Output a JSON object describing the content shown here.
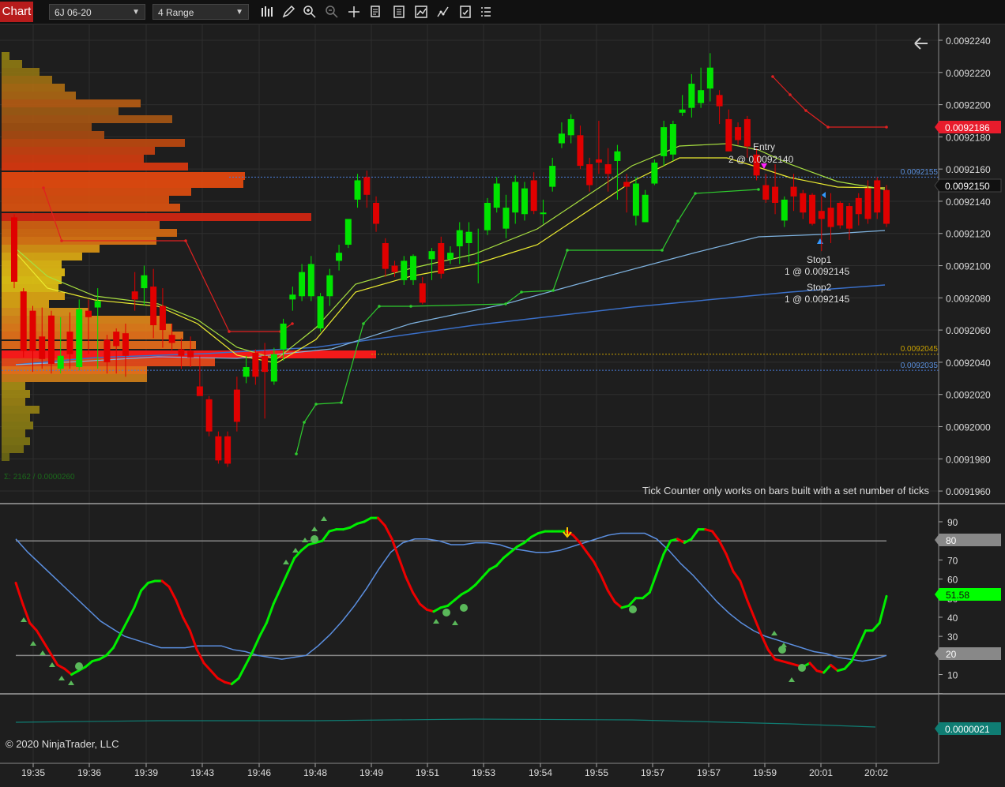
{
  "toolbar": {
    "tab_label": "Chart",
    "instrument": "6J 06-20",
    "bar_type": "4 Range",
    "icons": [
      "bar-type-icon",
      "draw-icon",
      "zoom-in-icon",
      "zoom-out-icon",
      "crosshair-icon",
      "data-box-icon",
      "properties-icon",
      "indicators-icon",
      "strategies-icon",
      "templates-icon"
    ]
  },
  "price_axis": {
    "ticks": [
      "0.0092240",
      "0.0092220",
      "0.0092200",
      "0.0092180",
      "0.0092160",
      "0.0092140",
      "0.0092120",
      "0.0092100",
      "0.0092080",
      "0.0092060",
      "0.0092040",
      "0.0092020",
      "0.0092000",
      "0.0091980",
      "0.0091960"
    ],
    "last_price_label": "0.0092150",
    "stop_price_label": "0.0092186",
    "level_labels": [
      "0.0092155",
      "0.0092045",
      "0.0092035"
    ]
  },
  "annotations": {
    "entry_title": "Entry",
    "entry_detail": "2 @ 0.0092140",
    "stop1_title": "Stop1",
    "stop1_detail": "1 @ 0.0092145",
    "stop2_title": "Stop2",
    "stop2_detail": "1 @ 0.0092145",
    "tick_counter_msg": "Tick Counter only works on bars built with a set number of ticks",
    "volume_profile_sum": "Σ: 2162 / 0.0000260",
    "copyright": "© 2020 NinjaTrader, LLC"
  },
  "osc_axis": {
    "ticks": [
      "90",
      "70",
      "60",
      "50",
      "40",
      "30",
      "10"
    ],
    "overbought_label": "80",
    "oversold_label": "20",
    "current_label": "51.58"
  },
  "bottom_panel": {
    "value_label": "0.0000021"
  },
  "time_axis": {
    "labels": [
      "19:35",
      "19:36",
      "19:39",
      "19:43",
      "19:46",
      "19:48",
      "19:49",
      "19:51",
      "19:53",
      "19:54",
      "19:55",
      "19:57",
      "19:57",
      "19:59",
      "20:01",
      "20:02"
    ]
  },
  "colors": {
    "background": "#1e1e1e",
    "up_candle": "#00e400",
    "down_candle": "#e00000",
    "stop_label": "#e81c2c",
    "price_label": "#111111",
    "osc_current": "#00ff00",
    "bottom_label": "#0f7d73"
  },
  "chart_data": [
    {
      "type": "candlestick",
      "title": "6J 06-20 4 Range",
      "ylim": [
        0.0091955,
        0.009225
      ],
      "y_ticks": [
        0.009224,
        0.009222,
        0.00922,
        0.009218,
        0.009216,
        0.009214,
        0.009212,
        0.00921,
        0.009208,
        0.009206,
        0.009204,
        0.009202,
        0.0092,
        0.009198,
        0.009196
      ],
      "candles": [
        {
          "o": 0.009213,
          "h": 0.0092132,
          "l": 0.0092086,
          "c": 0.009209
        },
        {
          "o": 0.0092084,
          "h": 0.0092086,
          "l": 0.0092043,
          "c": 0.0092047
        },
        {
          "o": 0.0092072,
          "h": 0.0092075,
          "l": 0.0092034,
          "c": 0.0092047
        },
        {
          "o": 0.0092056,
          "h": 0.0092074,
          "l": 0.0092036,
          "c": 0.0092042
        },
        {
          "o": 0.0092069,
          "h": 0.0092072,
          "l": 0.0092033,
          "c": 0.0092039
        },
        {
          "o": 0.0092036,
          "h": 0.0092068,
          "l": 0.0092033,
          "c": 0.0092044
        },
        {
          "o": 0.0092059,
          "h": 0.0092071,
          "l": 0.0092036,
          "c": 0.0092045
        },
        {
          "o": 0.0092037,
          "h": 0.0092079,
          "l": 0.0092035,
          "c": 0.0092073
        },
        {
          "o": 0.0092072,
          "h": 0.0092079,
          "l": 0.0092045,
          "c": 0.0092068
        },
        {
          "o": 0.0092074,
          "h": 0.0092086,
          "l": 0.0092036,
          "c": 0.0092078
        },
        {
          "o": 0.0092054,
          "h": 0.0092057,
          "l": 0.0092033,
          "c": 0.009204
        },
        {
          "o": 0.0092059,
          "h": 0.0092061,
          "l": 0.0092033,
          "c": 0.009205
        },
        {
          "o": 0.0092058,
          "h": 0.0092064,
          "l": 0.0092031,
          "c": 0.0092044
        },
        {
          "o": 0.0092084,
          "h": 0.0092096,
          "l": 0.0092072,
          "c": 0.0092079
        },
        {
          "o": 0.0092086,
          "h": 0.00921,
          "l": 0.0092075,
          "c": 0.0092094
        },
        {
          "o": 0.0092087,
          "h": 0.0092098,
          "l": 0.0092055,
          "c": 0.0092063
        },
        {
          "o": 0.0092075,
          "h": 0.0092086,
          "l": 0.0092049,
          "c": 0.009206
        },
        {
          "o": 0.0092057,
          "h": 0.0092064,
          "l": 0.0092047,
          "c": 0.0092052
        },
        {
          "o": 0.0092048,
          "h": 0.0092055,
          "l": 0.0092036,
          "c": 0.0092044
        },
        {
          "o": 0.0092047,
          "h": 0.0092056,
          "l": 0.0092037,
          "c": 0.0092043
        },
        {
          "o": 0.0092025,
          "h": 0.0092044,
          "l": 0.0092022,
          "c": 0.0092019
        },
        {
          "o": 0.0092017,
          "h": 0.0092019,
          "l": 0.0091994,
          "c": 0.0091997
        },
        {
          "o": 0.0091994,
          "h": 0.0091997,
          "l": 0.0091977,
          "c": 0.0091979
        },
        {
          "o": 0.0091994,
          "h": 0.0091997,
          "l": 0.0091975,
          "c": 0.0091977
        },
        {
          "o": 0.0092023,
          "h": 0.0092031,
          "l": 0.0091997,
          "c": 0.0092003
        },
        {
          "o": 0.0092031,
          "h": 0.0092044,
          "l": 0.0092027,
          "c": 0.0092037
        },
        {
          "o": 0.0092046,
          "h": 0.0092048,
          "l": 0.0092026,
          "c": 0.0092031
        },
        {
          "o": 0.0092044,
          "h": 0.0092052,
          "l": 0.0092005,
          "c": 0.0092034
        },
        {
          "o": 0.0092028,
          "h": 0.0092049,
          "l": 0.0092026,
          "c": 0.0092045
        },
        {
          "o": 0.0092048,
          "h": 0.0092067,
          "l": 0.0092041,
          "c": 0.0092064
        },
        {
          "o": 0.0092079,
          "h": 0.0092087,
          "l": 0.0092072,
          "c": 0.0092082
        },
        {
          "o": 0.0092081,
          "h": 0.0092101,
          "l": 0.0092078,
          "c": 0.0092096
        },
        {
          "o": 0.0092081,
          "h": 0.0092106,
          "l": 0.0092078,
          "c": 0.0092101
        },
        {
          "o": 0.0092061,
          "h": 0.0092083,
          "l": 0.0092059,
          "c": 0.0092081
        },
        {
          "o": 0.0092081,
          "h": 0.0092098,
          "l": 0.0092075,
          "c": 0.0092094
        },
        {
          "o": 0.0092103,
          "h": 0.0092113,
          "l": 0.0092097,
          "c": 0.0092108
        },
        {
          "o": 0.0092113,
          "h": 0.0092128,
          "l": 0.0092111,
          "c": 0.0092129
        },
        {
          "o": 0.0092141,
          "h": 0.0092157,
          "l": 0.0092136,
          "c": 0.0092153
        },
        {
          "o": 0.0092155,
          "h": 0.0092159,
          "l": 0.0092136,
          "c": 0.0092144
        },
        {
          "o": 0.0092139,
          "h": 0.0092143,
          "l": 0.0092121,
          "c": 0.0092126
        },
        {
          "o": 0.0092114,
          "h": 0.0092117,
          "l": 0.0092093,
          "c": 0.0092098
        },
        {
          "o": 0.00921,
          "h": 0.0092103,
          "l": 0.0092093,
          "c": 0.0092096
        },
        {
          "o": 0.0092091,
          "h": 0.0092106,
          "l": 0.0092088,
          "c": 0.0092103
        },
        {
          "o": 0.0092091,
          "h": 0.0092107,
          "l": 0.0092088,
          "c": 0.0092106
        },
        {
          "o": 0.0092089,
          "h": 0.0092093,
          "l": 0.0092076,
          "c": 0.0092077
        },
        {
          "o": 0.0092104,
          "h": 0.0092111,
          "l": 0.0092091,
          "c": 0.0092109
        },
        {
          "o": 0.0092114,
          "h": 0.0092118,
          "l": 0.0092092,
          "c": 0.0092095
        },
        {
          "o": 0.0092104,
          "h": 0.0092112,
          "l": 0.0092101,
          "c": 0.0092108
        },
        {
          "o": 0.0092112,
          "h": 0.0092127,
          "l": 0.0092101,
          "c": 0.0092122
        },
        {
          "o": 0.0092114,
          "h": 0.0092127,
          "l": 0.0092102,
          "c": 0.0092121
        },
        {
          "o": 0.0092102,
          "h": 0.0092123,
          "l": 0.0092089,
          "c": 0.0092102
        },
        {
          "o": 0.0092122,
          "h": 0.0092142,
          "l": 0.0092119,
          "c": 0.0092139
        },
        {
          "o": 0.0092136,
          "h": 0.0092155,
          "l": 0.0092133,
          "c": 0.0092151
        },
        {
          "o": 0.0092123,
          "h": 0.0092144,
          "l": 0.0092117,
          "c": 0.0092136
        },
        {
          "o": 0.0092133,
          "h": 0.0092156,
          "l": 0.0092126,
          "c": 0.0092152
        },
        {
          "o": 0.0092132,
          "h": 0.0092152,
          "l": 0.0092128,
          "c": 0.0092148
        },
        {
          "o": 0.0092153,
          "h": 0.0092158,
          "l": 0.0092132,
          "c": 0.0092134
        },
        {
          "o": 0.0092132,
          "h": 0.0092141,
          "l": 0.0092126,
          "c": 0.0092133
        },
        {
          "o": 0.0092149,
          "h": 0.0092167,
          "l": 0.0092146,
          "c": 0.0092162
        },
        {
          "o": 0.0092176,
          "h": 0.0092189,
          "l": 0.0092173,
          "c": 0.0092182
        },
        {
          "o": 0.0092181,
          "h": 0.0092194,
          "l": 0.0092176,
          "c": 0.0092191
        },
        {
          "o": 0.0092181,
          "h": 0.0092187,
          "l": 0.009216,
          "c": 0.0092162
        },
        {
          "o": 0.0092163,
          "h": 0.0092167,
          "l": 0.0092146,
          "c": 0.009215
        },
        {
          "o": 0.0092166,
          "h": 0.009219,
          "l": 0.0092157,
          "c": 0.0092164
        },
        {
          "o": 0.0092163,
          "h": 0.0092173,
          "l": 0.0092146,
          "c": 0.0092157
        },
        {
          "o": 0.0092165,
          "h": 0.0092175,
          "l": 0.0092141,
          "c": 0.0092171
        },
        {
          "o": 0.0092152,
          "h": 0.0092157,
          "l": 0.0092133,
          "c": 0.0092149
        },
        {
          "o": 0.0092131,
          "h": 0.0092155,
          "l": 0.0092125,
          "c": 0.0092151
        },
        {
          "o": 0.0092127,
          "h": 0.0092147,
          "l": 0.0092127,
          "c": 0.0092144
        },
        {
          "o": 0.0092151,
          "h": 0.0092166,
          "l": 0.009215,
          "c": 0.0092164
        },
        {
          "o": 0.0092168,
          "h": 0.009219,
          "l": 0.0092162,
          "c": 0.0092186
        },
        {
          "o": 0.0092169,
          "h": 0.009219,
          "l": 0.0092165,
          "c": 0.0092188
        },
        {
          "o": 0.0092195,
          "h": 0.0092206,
          "l": 0.0092193,
          "c": 0.0092197
        },
        {
          "o": 0.0092198,
          "h": 0.0092219,
          "l": 0.0092192,
          "c": 0.0092213
        },
        {
          "o": 0.0092201,
          "h": 0.0092223,
          "l": 0.0092198,
          "c": 0.0092209
        },
        {
          "o": 0.009221,
          "h": 0.0092232,
          "l": 0.0092202,
          "c": 0.0092223
        },
        {
          "o": 0.0092206,
          "h": 0.0092209,
          "l": 0.0092188,
          "c": 0.0092199
        },
        {
          "o": 0.0092191,
          "h": 0.0092197,
          "l": 0.0092171,
          "c": 0.0092171
        },
        {
          "o": 0.0092186,
          "h": 0.0092189,
          "l": 0.0092175,
          "c": 0.0092178
        },
        {
          "o": 0.0092191,
          "h": 0.0092193,
          "l": 0.0092167,
          "c": 0.0092174
        },
        {
          "o": 0.0092169,
          "h": 0.0092173,
          "l": 0.0092153,
          "c": 0.0092156
        },
        {
          "o": 0.009215,
          "h": 0.0092157,
          "l": 0.0092139,
          "c": 0.0092141
        },
        {
          "o": 0.0092149,
          "h": 0.0092163,
          "l": 0.0092132,
          "c": 0.0092139
        },
        {
          "o": 0.0092128,
          "h": 0.0092143,
          "l": 0.0092124,
          "c": 0.0092141
        },
        {
          "o": 0.0092149,
          "h": 0.0092157,
          "l": 0.0092134,
          "c": 0.0092143
        },
        {
          "o": 0.0092145,
          "h": 0.0092147,
          "l": 0.0092129,
          "c": 0.0092133
        },
        {
          "o": 0.0092144,
          "h": 0.0092145,
          "l": 0.0092125,
          "c": 0.0092126
        },
        {
          "o": 0.0092134,
          "h": 0.0092143,
          "l": 0.0092109,
          "c": 0.0092129
        },
        {
          "o": 0.0092136,
          "h": 0.0092145,
          "l": 0.0092114,
          "c": 0.0092124
        },
        {
          "o": 0.0092139,
          "h": 0.009214,
          "l": 0.0092123,
          "c": 0.0092125
        },
        {
          "o": 0.0092137,
          "h": 0.0092139,
          "l": 0.0092116,
          "c": 0.0092123
        },
        {
          "o": 0.0092142,
          "h": 0.0092145,
          "l": 0.0092125,
          "c": 0.0092132
        },
        {
          "o": 0.0092148,
          "h": 0.0092153,
          "l": 0.0092126,
          "c": 0.0092129
        },
        {
          "o": 0.0092153,
          "h": 0.0092155,
          "l": 0.0092129,
          "c": 0.0092133
        },
        {
          "o": 0.0092147,
          "h": 0.009215,
          "l": 0.0092124,
          "c": 0.0092126
        }
      ],
      "price_levels": [
        0.0092155,
        0.0092045,
        0.0092035
      ],
      "last_price": 0.009215,
      "stop_price": 0.0092186
    },
    {
      "type": "line",
      "ylim": [
        0,
        100
      ],
      "y_ticks": [
        90,
        80,
        70,
        60,
        50,
        40,
        30,
        20,
        10
      ],
      "overbought": 80,
      "oversold": 20,
      "current": 51.58,
      "series": [
        {
          "values": [
            58,
            47,
            37,
            33,
            27,
            21,
            15,
            13,
            10,
            12,
            14,
            17,
            18,
            20,
            24,
            31,
            38,
            45,
            54,
            58,
            59,
            59,
            56,
            49,
            40,
            33,
            23,
            16,
            12,
            8,
            6,
            5,
            8,
            15,
            22,
            30,
            37,
            47,
            55,
            63,
            71,
            75,
            78,
            79,
            80,
            85,
            86,
            86,
            87,
            89,
            90,
            92,
            92,
            88,
            81,
            71,
            61,
            53,
            47,
            44,
            43,
            45,
            46,
            49,
            52,
            54,
            57,
            61,
            65,
            67,
            71,
            74,
            77,
            79,
            82,
            84,
            85,
            85,
            85,
            85,
            83,
            79,
            74,
            69,
            62,
            54,
            48,
            45,
            46,
            50,
            50,
            53,
            63,
            73,
            80,
            81,
            79,
            81,
            86,
            86,
            85,
            80,
            73,
            64,
            59,
            49,
            40,
            31,
            23,
            18,
            17,
            16,
            15,
            14,
            16,
            12,
            11,
            15,
            12,
            13,
            17,
            25,
            33,
            33,
            37,
            51
          ]
        },
        {
          "values": [
            81,
            74,
            68,
            62,
            56,
            50,
            44,
            38,
            34,
            30,
            28,
            26,
            24,
            24,
            24,
            25,
            25,
            25,
            23,
            22,
            20,
            19,
            18,
            19,
            20,
            25,
            31,
            38,
            46,
            55,
            65,
            74,
            79,
            81,
            81,
            80,
            78,
            78,
            79,
            79,
            78,
            76,
            75,
            74,
            74,
            75,
            77,
            79,
            81,
            83,
            84,
            84,
            84,
            81,
            75,
            68,
            62,
            55,
            48,
            42,
            37,
            33,
            30,
            28,
            26,
            24,
            22,
            21,
            19,
            18,
            17,
            18,
            20
          ]
        }
      ]
    },
    {
      "type": "line",
      "series": [
        {
          "values": [
            2.1e-06,
            2.1e-06,
            2.1e-06,
            2.1e-06,
            2.1e-06,
            2.1e-06
          ]
        }
      ]
    }
  ]
}
